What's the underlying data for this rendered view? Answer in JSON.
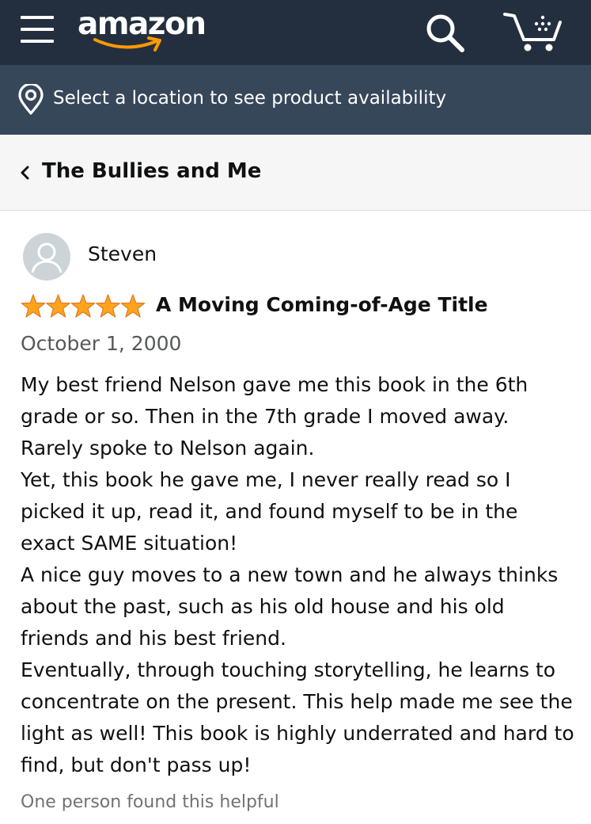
{
  "header": {
    "logo_text": "amazon",
    "background_color": "#232f3e"
  },
  "location": {
    "text": "Select a location to see product availability",
    "background_color": "#37475a"
  },
  "breadcrumb": {
    "title": "The Bullies and Me"
  },
  "review": {
    "reviewer": "Steven",
    "rating": 5,
    "rating_max": 5,
    "star_color": "#ffa41c",
    "title": "A Moving Coming-of-Age Title",
    "date": "October 1, 2000",
    "paragraphs": [
      "My best friend Nelson gave me this book in the 6th grade or so. Then in the 7th grade I moved away. Rarely spoke to Nelson again.",
      "Yet, this book he gave me, I never really read so I picked it up, read it, and found myself to be in the exact SAME situation!",
      "A nice guy moves to a new town and he always thinks about the past, such as his old house and his old friends and his best friend.",
      "Eventually, through touching storytelling, he learns to concentrate on the present. This help made me see the light as well! This book is highly underrated and hard to find, but don't pass up!"
    ],
    "helpful_text": "One person found this helpful"
  },
  "icons": {
    "menu": "hamburger-menu-icon",
    "search": "search-icon",
    "cart": "cart-icon",
    "location": "location-pin-icon",
    "back": "chevron-left-icon",
    "avatar": "user-avatar-icon",
    "star": "star-icon"
  }
}
